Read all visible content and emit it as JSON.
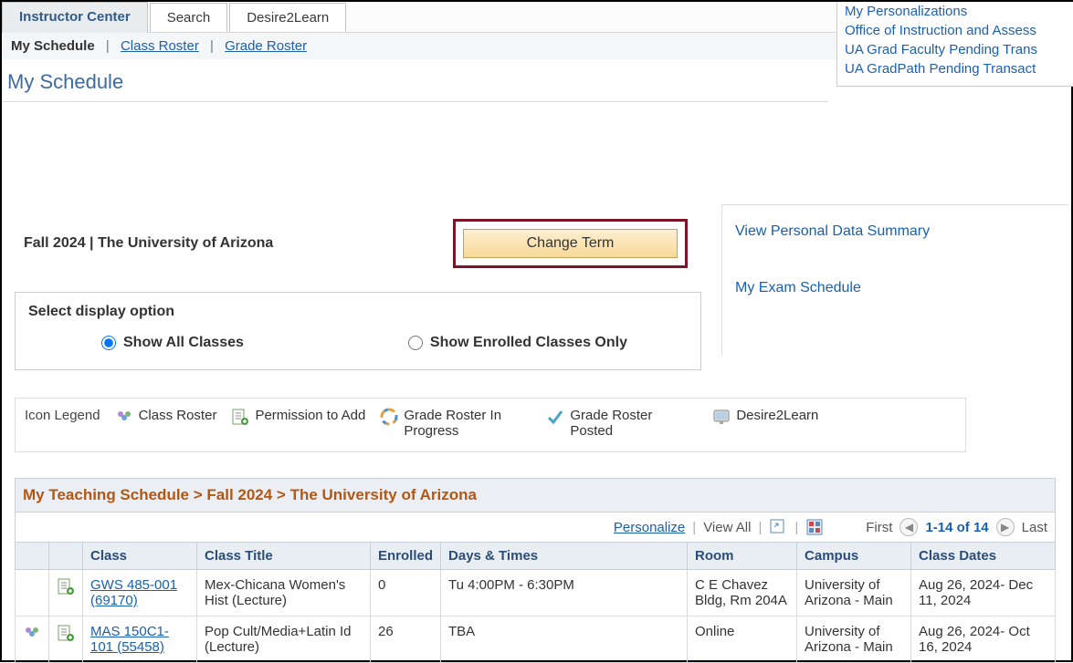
{
  "side_links": {
    "personalizations": "My Personalizations",
    "office": "Office of Instruction and Assess",
    "grad_faculty": "UA Grad Faculty Pending Trans",
    "gradpath": "UA GradPath Pending Transact"
  },
  "tabs": {
    "instructor_center": "Instructor Center",
    "search": "Search",
    "d2l": "Desire2Learn"
  },
  "subnav": {
    "my_schedule": "My Schedule",
    "class_roster": "Class Roster",
    "grade_roster": "Grade Roster"
  },
  "page_title": "My Schedule",
  "term_text": "Fall 2024 | The University of Arizona",
  "change_term_label": "Change Term",
  "right_quick": {
    "personal_data": "View Personal Data Summary",
    "exam_schedule": "My Exam Schedule"
  },
  "display_option": {
    "heading": "Select display option",
    "opt_all": "Show All Classes",
    "opt_enrolled": "Show Enrolled Classes Only"
  },
  "legend": {
    "label": "Icon Legend",
    "class_roster": "Class Roster",
    "permission": "Permission to Add",
    "grade_progress": "Grade Roster In Progress",
    "grade_posted": "Grade Roster Posted",
    "d2l": "Desire2Learn"
  },
  "sched_header": "My Teaching Schedule > Fall 2024 > The University of Arizona",
  "tbl_tools": {
    "personalize": "Personalize",
    "view_all": "View All",
    "first": "First",
    "range": "1-14 of 14",
    "last": "Last"
  },
  "columns": {
    "class": "Class",
    "class_title": "Class Title",
    "enrolled": "Enrolled",
    "days_times": "Days & Times",
    "room": "Room",
    "campus": "Campus",
    "class_dates": "Class Dates"
  },
  "rows": [
    {
      "has_roster_icon": false,
      "has_perm_icon": true,
      "class": "GWS 485-001 (69170)",
      "title": "Mex-Chicana Women's Hist (Lecture)",
      "enrolled": "0",
      "days": "Tu 4:00PM - 6:30PM",
      "room": "C E Chavez Bldg, Rm 204A",
      "campus": "University of Arizona - Main",
      "dates": "Aug 26, 2024- Dec 11, 2024"
    },
    {
      "has_roster_icon": true,
      "has_perm_icon": true,
      "class": "MAS 150C1-101 (55458)",
      "title": "Pop Cult/Media+Latin Id (Lecture)",
      "enrolled": "26",
      "days": "TBA",
      "room": "Online",
      "campus": "University of Arizona - Main",
      "dates": "Aug 26, 2024- Oct 16, 2024"
    }
  ]
}
